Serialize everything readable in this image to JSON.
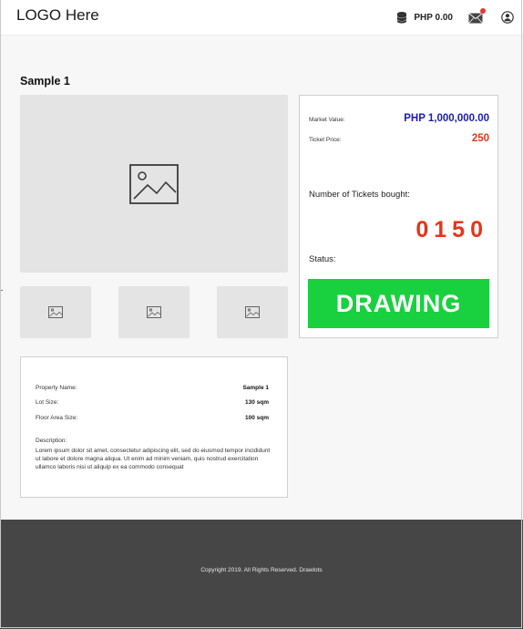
{
  "header": {
    "logo": "LOGO Here",
    "balance": "PHP 0.00",
    "icons": [
      "coins-icon",
      "mail-icon",
      "user-icon"
    ],
    "notification_color": "#e53935"
  },
  "page": {
    "title": "Sample 1"
  },
  "listing": {
    "market_value_label": "Market Value:",
    "market_value": "PHP 1,000,000.00",
    "ticket_price_label": "Ticket Price:",
    "ticket_price": "250",
    "tickets_label": "Number of Tickets bought:",
    "tickets_count": "0150",
    "status_label": "Status:",
    "status": "DRAWING",
    "colors": {
      "market_value": "#1a1ab8",
      "price": "#e53518",
      "status": "#19d13f"
    }
  },
  "details": {
    "property_name_label": "Property Name:",
    "property_name": "Sample 1",
    "lot_size_label": "Lot Size:",
    "lot_size": "130 sqm",
    "floor_area_label": "Floor Area Size:",
    "floor_area": "100 sqm",
    "description_label": "Description:",
    "description": "Lorem ipsum dolor sit amet, consectetur adipiscing elit, sed do eiusmod tempor incididunt ut labore et dolore magna aliqua. Ut enim ad minim veniam, quis nostrud exercitation ullamco laboris nisi ut aliquip ex ea commodo consequat"
  },
  "footer": {
    "copyright": "Copyright 2019. All Rights Reserved. Drawlots"
  }
}
